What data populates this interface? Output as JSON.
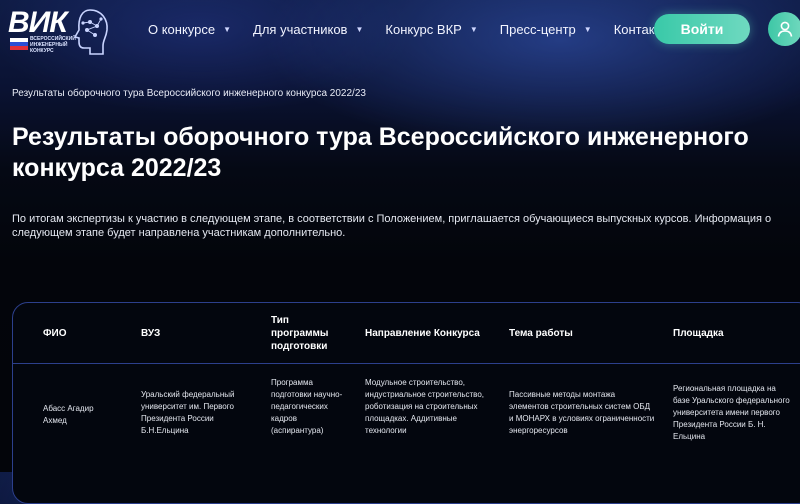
{
  "logo": {
    "text": "ВИК",
    "subtitle_lines": [
      "ВСЕРОССИЙСКИЙ",
      "ИНЖЕНЕРНЫЙ",
      "КОНКУРС"
    ]
  },
  "nav": {
    "items": [
      {
        "label": "О конкурсе",
        "has_dropdown": true
      },
      {
        "label": "Для участников",
        "has_dropdown": true
      },
      {
        "label": "Конкурс ВКР",
        "has_dropdown": true
      },
      {
        "label": "Пресс-центр",
        "has_dropdown": true
      },
      {
        "label": "Контакты",
        "has_dropdown": false
      }
    ],
    "login_label": "Войти",
    "user_icon": "user-icon"
  },
  "breadcrumb": "Результаты оборочного тура Всероссийского инженерного конкурса 2022/23",
  "page_title": "Результаты оборочного тура Всероссийского инженерного конкурса 2022/23",
  "intro": "По итогам экспертизы к участию в следующем этапе, в соответствии с Положением, приглашается обучающиеся выпускных курсов. Информация о следующем этапе будет направлена участникам дополнительно.",
  "table": {
    "headers": [
      "ФИО",
      "ВУЗ",
      "Тип программы подготовки",
      "Направление Конкурса",
      "Тема работы",
      "Площадка"
    ],
    "rows": [
      {
        "cells": [
          "Абасс Агадир Ахмед",
          "Уральский федеральный университет им. Первого Президента России Б.Н.Ельцина",
          "Программа подготовки научно-педагогических кадров (аспирантура)",
          "Модульное строительство, индустриальное строительство, роботизация на строительных площадках. Аддитивные технологии",
          "Пассивные методы монтажа элементов строительных систем ОБД и МОНАРХ в условиях ограниченности энергоресурсов",
          "Региональная площадка на базе Уральского федерального университета имени первого Президента России Б. Н. Ельцина"
        ]
      }
    ]
  },
  "colors": {
    "accent": "#4fd1b3",
    "table_border": "#2c3f8c",
    "header_glow": "#375abe"
  }
}
